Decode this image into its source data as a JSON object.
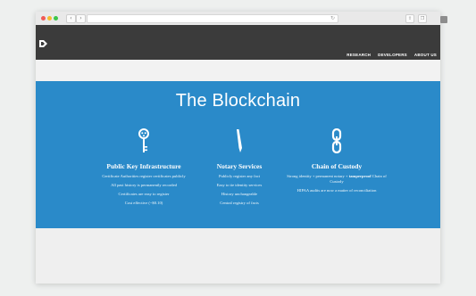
{
  "nav": {
    "items": [
      "RESEARCH",
      "DEVELOPERS",
      "ABOUT US"
    ]
  },
  "hero": {
    "title": "The Blockchain",
    "columns": [
      {
        "icon": "key-icon",
        "heading": "Public Key Infrastructure",
        "lines": [
          "Certificate Authorities register certificates publicly",
          "All past history is permanently recorded",
          "Certificates are easy to register",
          "Cost effective (~$0.10)"
        ]
      },
      {
        "icon": "pen-icon",
        "heading": "Notary Services",
        "lines": [
          "Publicly register any fact",
          "Easy to tie identity services",
          "History unchangeable",
          "Central registry of facts"
        ]
      },
      {
        "icon": "chain-icon",
        "heading": "Chain of Custody",
        "lines_rich": [
          {
            "before": "Strong identity + permanent notary + ",
            "strong": "tamperproof",
            "after": " Chain of Custody"
          }
        ],
        "lines": [
          "HIPAA audits are now a matter of reconciliation"
        ]
      }
    ]
  },
  "colors": {
    "header_bg": "#3b3b3b",
    "hero_bg": "#2a8ac9",
    "text": "#ffffff"
  }
}
